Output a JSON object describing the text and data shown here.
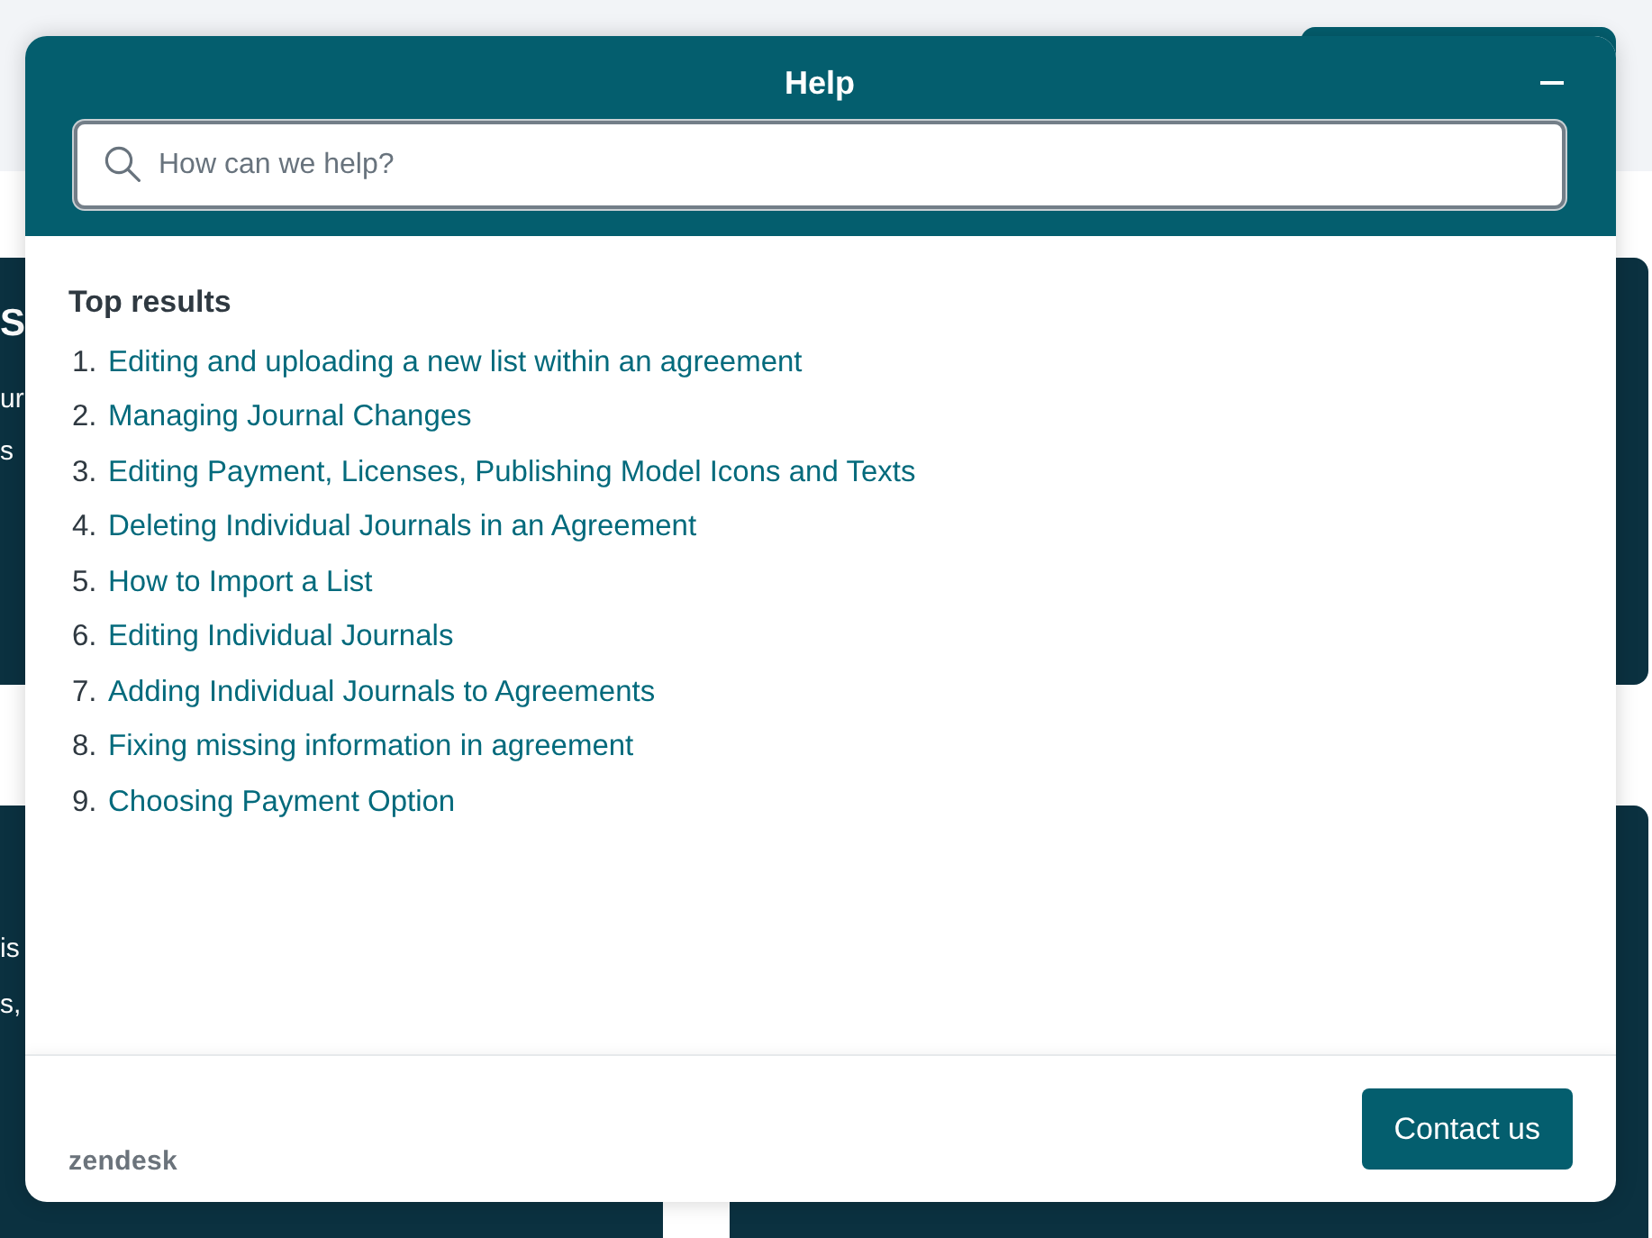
{
  "background_cards": [
    {
      "heading": "S",
      "lines": [
        "ur",
        "s"
      ]
    },
    {
      "lines": [
        "is",
        "s,"
      ]
    }
  ],
  "help_widget": {
    "title": "Help",
    "search": {
      "placeholder": "How can we help?"
    },
    "results_heading": "Top results",
    "results": [
      {
        "number": "1.",
        "title": "Editing and uploading a new list within an agreement"
      },
      {
        "number": "2.",
        "title": "Managing Journal Changes"
      },
      {
        "number": "3.",
        "title": "Editing Payment, Licenses, Publishing Model Icons and Texts"
      },
      {
        "number": "4.",
        "title": "Deleting Individual Journals in an Agreement"
      },
      {
        "number": "5.",
        "title": "How to Import a List"
      },
      {
        "number": "6.",
        "title": "Editing Individual Journals"
      },
      {
        "number": "7.",
        "title": "Adding Individual Journals to Agreements"
      },
      {
        "number": "8.",
        "title": "Fixing missing information in agreement"
      },
      {
        "number": "9.",
        "title": "Choosing Payment Option"
      }
    ],
    "brand": "zendesk",
    "contact_button": "Contact us"
  }
}
